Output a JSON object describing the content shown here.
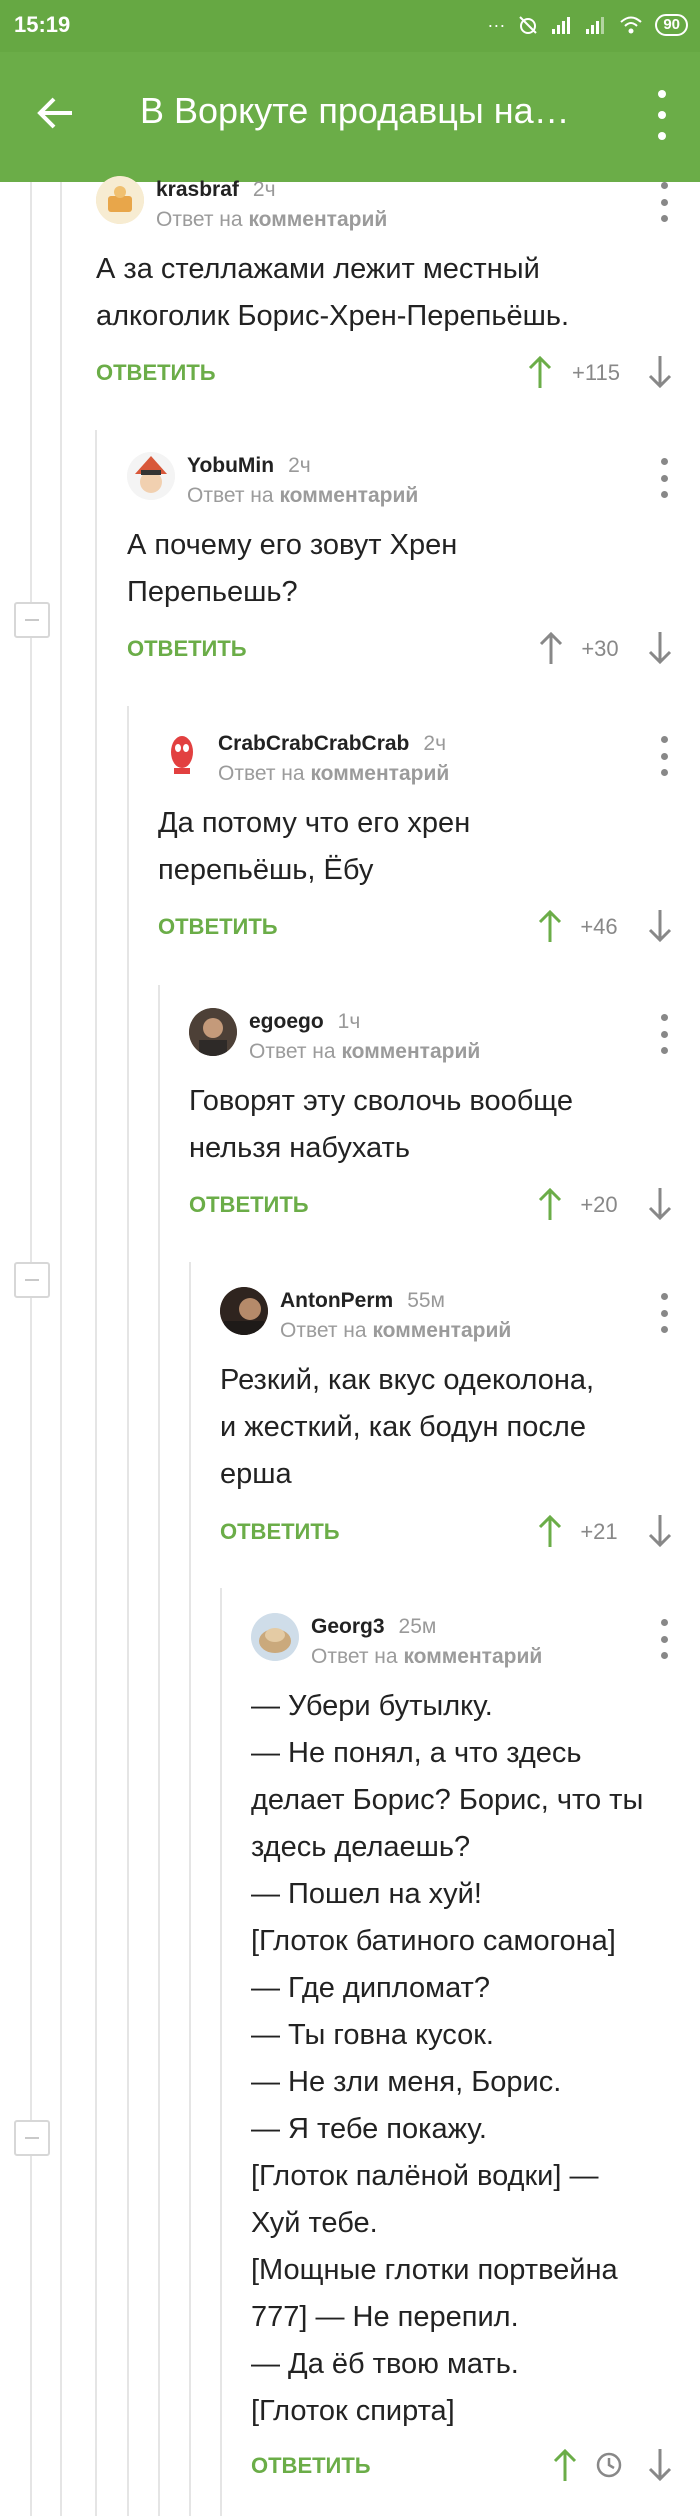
{
  "statusbar": {
    "time": "15:19",
    "battery": "90"
  },
  "appbar": {
    "title": "В Воркуте продавцы на…"
  },
  "comments": [
    {
      "author": "krasbraf",
      "time": "2ч",
      "reply_prefix": "Ответ на",
      "reply_target": "комментарий",
      "text": "А за стеллажами лежит местный\nалкоголик Борис-Хрен-Перепьёшь.",
      "reply": "ОТВЕТИТЬ",
      "score": "+115",
      "voted": "up"
    },
    {
      "author": "YobuMin",
      "time": "2ч",
      "reply_prefix": "Ответ на",
      "reply_target": "комментарий",
      "text": "А почему его зовут Хрен\nПерепьешь?",
      "reply": "ОТВЕТИТЬ",
      "score": "+30",
      "voted": "none"
    },
    {
      "author": "CrabCrabCrabCrab",
      "time": "2ч",
      "reply_prefix": "Ответ на",
      "reply_target": "комментарий",
      "text": "Да потому что его хрен\nперепьёшь, Ёбу",
      "reply": "ОТВЕТИТЬ",
      "score": "+46",
      "voted": "up"
    },
    {
      "author": "egoego",
      "time": "1ч",
      "reply_prefix": "Ответ на",
      "reply_target": "комментарий",
      "text": "Говорят эту сволочь вообще\nнельзя набухать",
      "reply": "ОТВЕТИТЬ",
      "score": "+20",
      "voted": "up"
    },
    {
      "author": "AntonPerm",
      "time": "55м",
      "reply_prefix": "Ответ на",
      "reply_target": "комментарий",
      "text": "Резкий, как вкус одеколона,\nи жесткий, как бодун после\nерша",
      "reply": "ОТВЕТИТЬ",
      "score": "+21",
      "voted": "up"
    },
    {
      "author": "Georg3",
      "time": "25м",
      "reply_prefix": "Ответ на",
      "reply_target": "комментарий",
      "text": "— Убери бутылку.\n— Не понял, а что здесь\nделает Борис? Борис, что ты\nздесь делаешь?\n— Пошел на хуй!\n[Глоток батиного самогона]\n— Где дипломат?\n— Ты говна кусок.\n— Не зли меня, Борис.\n— Я тебе покажу.\n[Глоток палёной водки] —\nХуй тебе.\n[Мощные глотки портвейна\n777] — Не перепил.\n— Да ёб твою мать.\n[Глоток спирта]",
      "reply": "ОТВЕТИТЬ",
      "score": "",
      "voted": "up"
    }
  ],
  "colors": {
    "brand": "#6bad48",
    "up": "#6bad48",
    "neutral": "#888888"
  }
}
